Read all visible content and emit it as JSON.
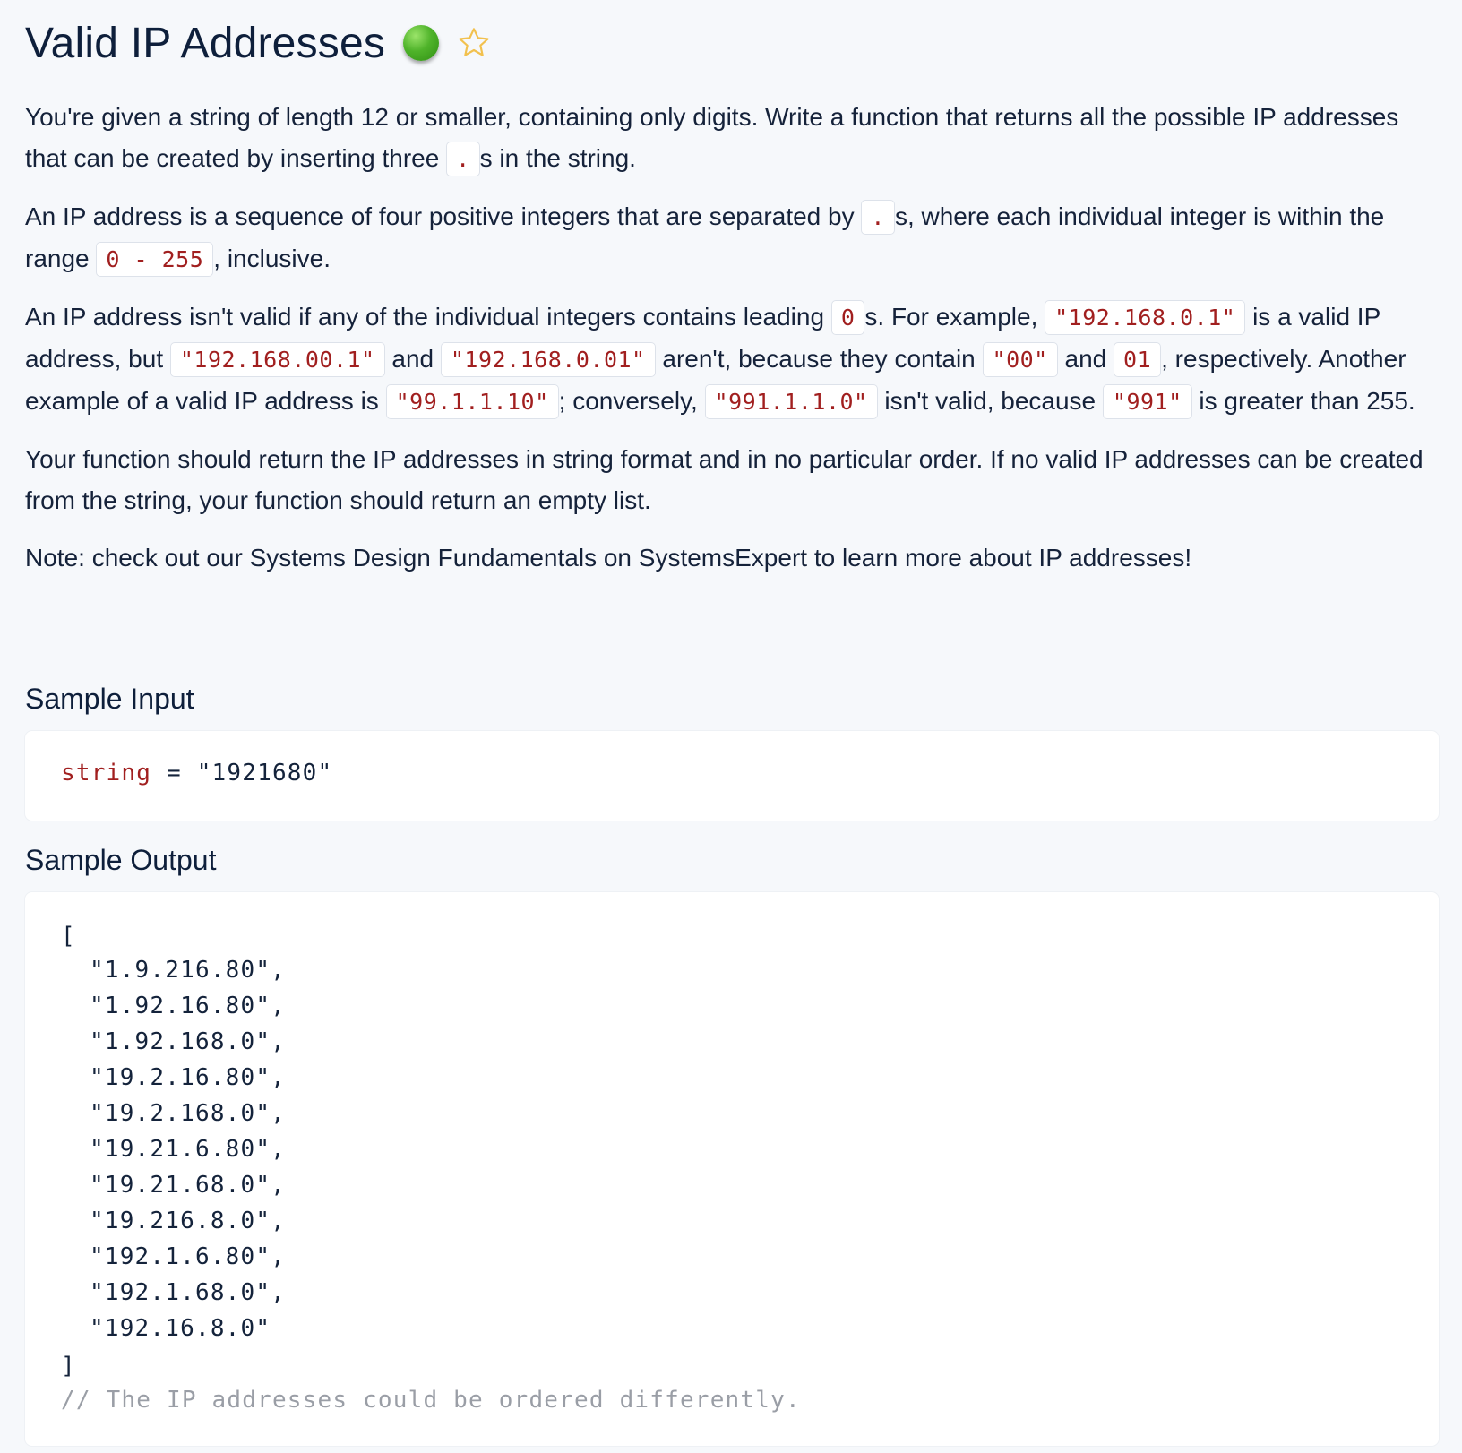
{
  "problem": {
    "title": "Valid IP Addresses",
    "status": "completed",
    "favorite_icon": "star-outline-icon",
    "status_color": "#4fb32a",
    "star_color": "#f5c542"
  },
  "description": {
    "p1": {
      "t1": "You're given a string of length 12 or smaller, containing only digits. Write a function that returns all the possible IP addresses that can be created by inserting three ",
      "c1": ".",
      "t2": "s in the string."
    },
    "p2": {
      "t1": "An IP address is a sequence of four positive integers that are separated by ",
      "c1": ".",
      "t2": "s, where each individual integer is within the range ",
      "c2": "0 - 255",
      "t3": ", inclusive."
    },
    "p3": {
      "t1": "An IP address isn't valid if any of the individual integers contains leading ",
      "c1": "0",
      "t2": "s. For example, ",
      "c2": "\"192.168.0.1\"",
      "t3": " is a valid IP address, but ",
      "c3": "\"192.168.00.1\"",
      "t4": " and ",
      "c4": "\"192.168.0.01\"",
      "t5": " aren't, because they contain ",
      "c5": "\"00\"",
      "t6": " and ",
      "c6": "01",
      "t7": ", respectively. Another example of a valid IP address is ",
      "c7": "\"99.1.1.10\"",
      "t8": "; conversely, ",
      "c8": "\"991.1.1.0\"",
      "t9": " isn't valid, because ",
      "c9": "\"991\"",
      "t10": " is greater than 255."
    },
    "p4": "Your function should return the IP addresses in string format and in no particular order. If no valid IP addresses can be created from the string, your function should return an empty list.",
    "p5": "Note: check out our Systems Design Fundamentals on SystemsExpert to learn more about IP addresses!"
  },
  "sample_input": {
    "heading": "Sample Input",
    "var_name": "string",
    "operator": " = ",
    "value": "\"1921680\""
  },
  "sample_output": {
    "heading": "Sample Output",
    "open": "[",
    "items": [
      "\"1.9.216.80\",",
      "\"1.92.16.80\",",
      "\"1.92.168.0\",",
      "\"19.2.16.80\",",
      "\"19.2.168.0\",",
      "\"19.21.6.80\",",
      "\"19.21.68.0\",",
      "\"19.216.8.0\",",
      "\"192.1.6.80\",",
      "\"192.1.68.0\",",
      "\"192.16.8.0\""
    ],
    "close": "]",
    "comment": "// The IP addresses could be ordered differently."
  }
}
